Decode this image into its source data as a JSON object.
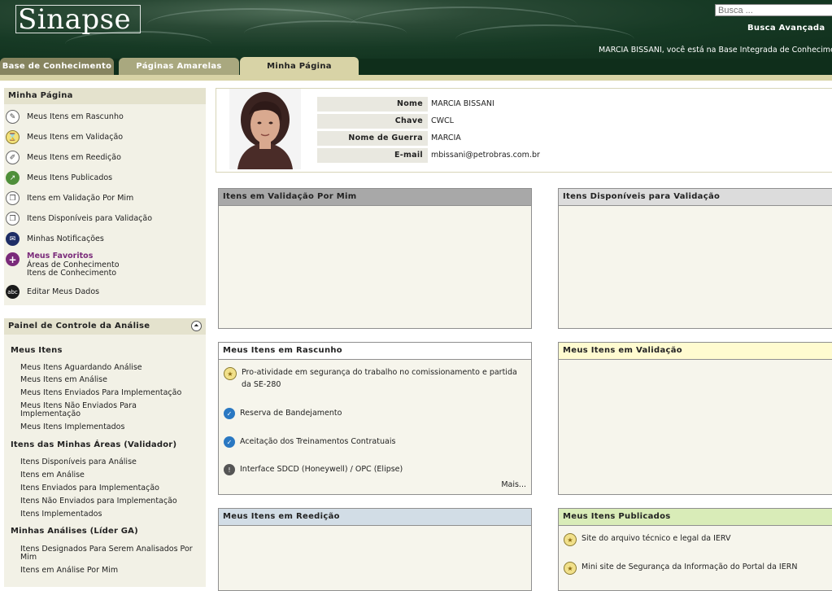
{
  "header": {
    "logo": "Sinapse",
    "search_placeholder": "Busca ...",
    "advanced_search": "Busca Avançada",
    "welcome": "MARCIA BISSANI, você está na Base Integrada de Conhecimento"
  },
  "tabs": [
    {
      "label": "Base de Conhecimento"
    },
    {
      "label": "Páginas Amarelas"
    },
    {
      "label": "Minha Página"
    }
  ],
  "sidebar": {
    "minha_pagina": {
      "title": "Minha Página",
      "items": [
        {
          "label": "Meus Itens em Rascunho",
          "icon": "draft-icon"
        },
        {
          "label": "Meus Itens em Validação",
          "icon": "hourglass-icon"
        },
        {
          "label": "Meus Itens em Reedição",
          "icon": "edit-icon"
        },
        {
          "label": "Meus Itens Publicados",
          "icon": "published-icon"
        },
        {
          "label": "Itens em Validação Por Mim",
          "icon": "documents-icon"
        },
        {
          "label": "Itens Disponíveis para Validação",
          "icon": "documents-available-icon"
        },
        {
          "label": "Minhas Notificações",
          "icon": "envelope-icon"
        },
        {
          "label": "Meus Favoritos",
          "icon": "plus-icon"
        },
        {
          "label": "Editar Meus Dados",
          "icon": "abc-icon"
        }
      ],
      "favoritos_sub": [
        "Áreas de Conhecimento",
        "Itens de Conhecimento"
      ]
    },
    "painel": {
      "title": "Painel de Controle da Análise",
      "sections": [
        {
          "title": "Meus Itens",
          "items": [
            "Meus Itens Aguardando Análise",
            "Meus Itens em Análise",
            "Meus Itens Enviados Para Implementação",
            "Meus Itens Não Enviados Para Implementação",
            "Meus Itens Implementados"
          ]
        },
        {
          "title": "Itens das Minhas Áreas (Validador)",
          "items": [
            "Itens Disponíveis para Análise",
            "Itens em Análise",
            "Itens Enviados para Implementação",
            "Itens Não Enviados para Implementação",
            "Itens Implementados"
          ]
        },
        {
          "title": "Minhas Análises (Líder GA)",
          "items": [
            "Itens Designados Para Serem Analisados Por Mim",
            "Itens em Análise Por Mim"
          ]
        }
      ]
    }
  },
  "profile": {
    "fields": [
      {
        "label": "Nome",
        "value": "MARCIA BISSANI"
      },
      {
        "label": "Chave",
        "value": "CWCL"
      },
      {
        "label": "Nome de Guerra",
        "value": "MARCIA"
      },
      {
        "label": "E-mail",
        "value": "mbissani@petrobras.com.br"
      }
    ]
  },
  "panels": {
    "validacao_por_mim": {
      "title": "Itens em Validação Por Mim",
      "color": "#a8a8a8"
    },
    "disponiveis": {
      "title": "Itens Disponíveis para Validação",
      "color": "#dcdcdc"
    },
    "rascunho": {
      "title": "Meus Itens em Rascunho",
      "color": "#ffffff",
      "items": [
        {
          "text": "Pro-atividade em segurança do trabalho no comissionamento e partida da SE-280",
          "icon": "star-icon"
        },
        {
          "text": "Reserva de Bandejamento",
          "icon": "check-icon"
        },
        {
          "text": "Aceitação dos Treinamentos Contratuais",
          "icon": "check-icon"
        },
        {
          "text": "Interface SDCD (Honeywell) / OPC (Elipse)",
          "icon": "exclamation-icon"
        }
      ],
      "more": "Mais..."
    },
    "validacao": {
      "title": "Meus Itens em Validação",
      "color": "#fffbd0"
    },
    "reedicao": {
      "title": "Meus Itens em Reedição",
      "color": "#d2dde6"
    },
    "publicados": {
      "title": "Meus Itens Publicados",
      "color": "#d9ecb8",
      "items": [
        {
          "text": "Site do arquivo técnico e legal da IERV",
          "icon": "star-icon"
        },
        {
          "text": "Mini site de Segurança da Informação do Portal da IERN",
          "icon": "star-icon"
        }
      ]
    }
  }
}
